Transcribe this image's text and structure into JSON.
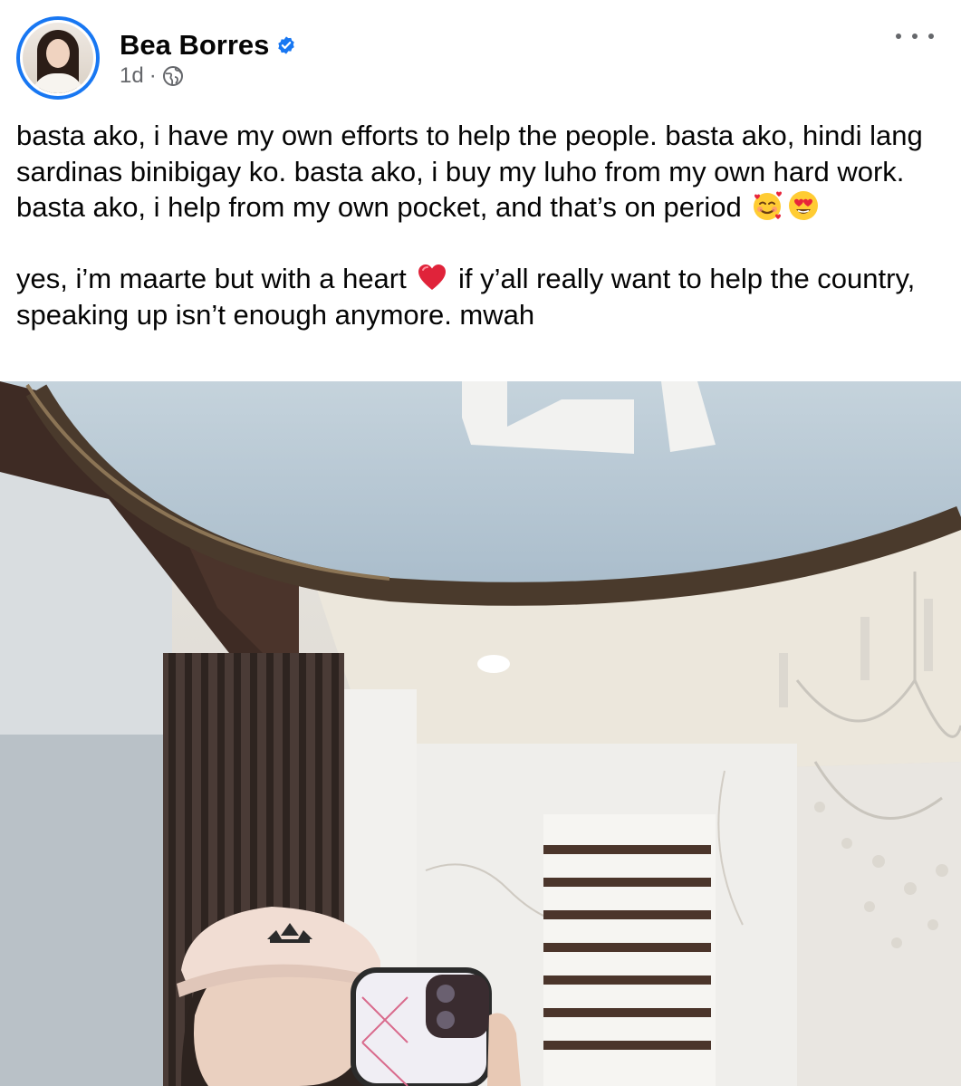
{
  "post": {
    "author": "Bea Borres",
    "verified": true,
    "time": "1d",
    "separator": "·",
    "privacy_icon": "globe-icon",
    "more_icon": "more-horizontal-icon",
    "paragraphs": [
      "basta ako, i have my own efforts to help the people. basta ako, hindi lang sardinas binibigay ko. basta ako, i buy my luho from my own hard work. basta ako, i help from my own pocket, and that’s on period",
      "yes, i’m maarte but with a heart",
      "if y’all really want to help the country, speaking up isn’t enough anymore. mwah"
    ],
    "emojis": [
      "smiling-face-with-hearts",
      "heart-eyes",
      "red-heart"
    ],
    "photo_icon": "mirror-selfie-photo"
  },
  "colors": {
    "accent": "#1877f2",
    "text": "#050505",
    "secondary": "#65676b"
  }
}
